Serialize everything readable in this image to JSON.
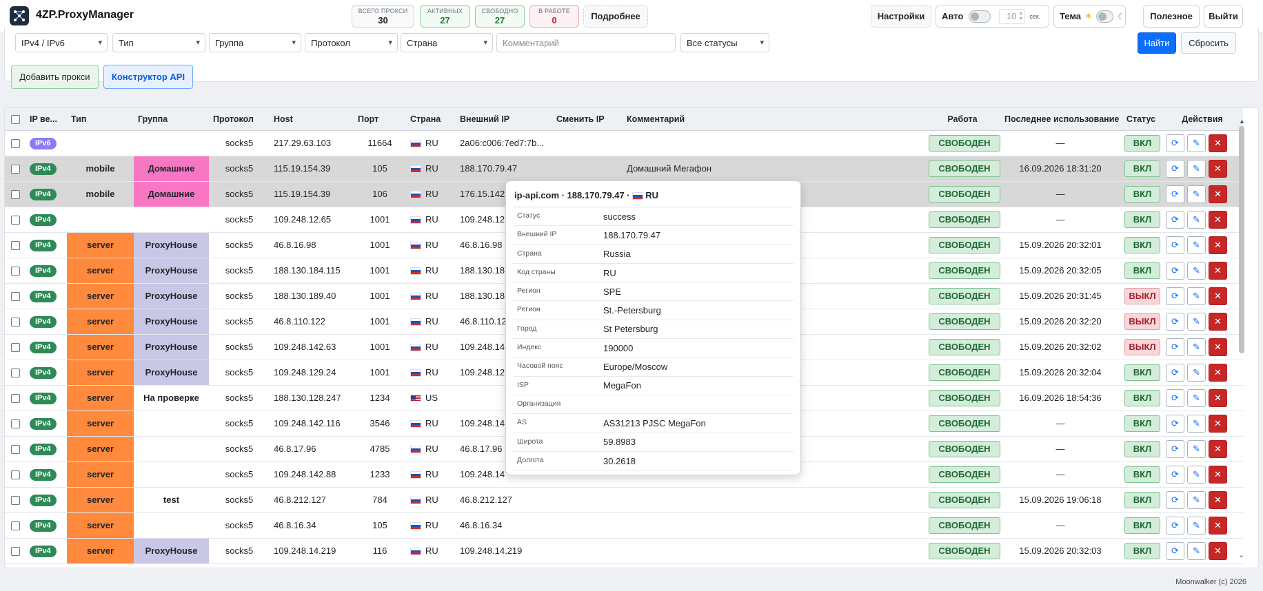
{
  "app": {
    "title": "4ZP.ProxyManager"
  },
  "stats": [
    {
      "label": "ВСЕГО ПРОКСИ",
      "value": "30"
    },
    {
      "label": "АКТИВНЫХ",
      "value": "27"
    },
    {
      "label": "СВОБОДНО",
      "value": "27"
    },
    {
      "label": "В РАБОТЕ",
      "value": "0"
    }
  ],
  "header": {
    "details_label": "Подробнее",
    "settings_label": "Настройки",
    "auto_label": "Авто",
    "auto_interval": "10",
    "auto_unit": "сек.",
    "theme_label": "Тема",
    "useful_label": "Полезное",
    "logout_label": "Выйти"
  },
  "filters": {
    "ip_version": "IPv4 / IPv6",
    "type": "Тип",
    "group": "Группа",
    "protocol": "Протокол",
    "country": "Страна",
    "comment_placeholder": "Комментарий",
    "status": "Все статусы",
    "find_label": "Найти",
    "reset_label": "Сбросить",
    "add_proxy_label": "Добавить прокси",
    "api_builder_label": "Конструктор API"
  },
  "table": {
    "columns": [
      "IP ве...",
      "Тип",
      "Группа",
      "Протокол",
      "Host",
      "Порт",
      "Страна",
      "Внешний IP",
      "Сменить IP",
      "Комментарий",
      "Работа",
      "Последнее использование",
      "Статус",
      "Действия"
    ],
    "rows": [
      {
        "ipv": "IPv6",
        "type": "",
        "group": "",
        "proto": "socks5",
        "host": "217.29.63.103",
        "port": "11664",
        "country": "RU",
        "ext": "2a06:c006:7ed7:7b...",
        "comment": "",
        "work": "СВОБОДЕН",
        "last": "—",
        "status": "ВКЛ"
      },
      {
        "ipv": "IPv4",
        "type": "mobile",
        "group": "Домашние",
        "proto": "socks5",
        "host": "115.19.154.39",
        "port": "105",
        "country": "RU",
        "ext": "188.170.79.47",
        "comment": "Домашний Мегафон",
        "work": "СВОБОДЕН",
        "last": "16.09.2026 18:31:20",
        "status": "ВКЛ"
      },
      {
        "ipv": "IPv4",
        "type": "mobile",
        "group": "Домашние",
        "proto": "socks5",
        "host": "115.19.154.39",
        "port": "106",
        "country": "RU",
        "ext": "176.15.142",
        "comment": "",
        "work": "СВОБОДЕН",
        "last": "—",
        "status": "ВКЛ"
      },
      {
        "ipv": "IPv4",
        "type": "",
        "group": "",
        "proto": "socks5",
        "host": "109.248.12.65",
        "port": "1001",
        "country": "RU",
        "ext": "109.248.12",
        "comment": "",
        "work": "СВОБОДЕН",
        "last": "—",
        "status": "ВКЛ"
      },
      {
        "ipv": "IPv4",
        "type": "server",
        "group": "ProxyHouse",
        "proto": "socks5",
        "host": "46.8.16.98",
        "port": "1001",
        "country": "RU",
        "ext": "46.8.16.98",
        "comment": "",
        "work": "СВОБОДЕН",
        "last": "15.09.2026 20:32:01",
        "status": "ВКЛ"
      },
      {
        "ipv": "IPv4",
        "type": "server",
        "group": "ProxyHouse",
        "proto": "socks5",
        "host": "188.130.184.115",
        "port": "1001",
        "country": "RU",
        "ext": "188.130.18",
        "comment": "",
        "work": "СВОБОДЕН",
        "last": "15.09.2026 20:32:05",
        "status": "ВКЛ"
      },
      {
        "ipv": "IPv4",
        "type": "server",
        "group": "ProxyHouse",
        "proto": "socks5",
        "host": "188.130.189.40",
        "port": "1001",
        "country": "RU",
        "ext": "188.130.18",
        "comment": "",
        "work": "СВОБОДЕН",
        "last": "15.09.2026 20:31:45",
        "status": "ВЫКЛ"
      },
      {
        "ipv": "IPv4",
        "type": "server",
        "group": "ProxyHouse",
        "proto": "socks5",
        "host": "46.8.110.122",
        "port": "1001",
        "country": "RU",
        "ext": "46.8.110.12",
        "comment": "",
        "work": "СВОБОДЕН",
        "last": "15.09.2026 20:32:20",
        "status": "ВЫКЛ"
      },
      {
        "ipv": "IPv4",
        "type": "server",
        "group": "ProxyHouse",
        "proto": "socks5",
        "host": "109.248.142.63",
        "port": "1001",
        "country": "RU",
        "ext": "109.248.14",
        "comment": "",
        "work": "СВОБОДЕН",
        "last": "15.09.2026 20:32:02",
        "status": "ВЫКЛ"
      },
      {
        "ipv": "IPv4",
        "type": "server",
        "group": "ProxyHouse",
        "proto": "socks5",
        "host": "109.248.129.24",
        "port": "1001",
        "country": "RU",
        "ext": "109.248.12",
        "comment": "",
        "work": "СВОБОДЕН",
        "last": "15.09.2026 20:32:04",
        "status": "ВКЛ"
      },
      {
        "ipv": "IPv4",
        "type": "server",
        "group": "На проверке",
        "proto": "socks5",
        "host": "188.130.128.247",
        "port": "1234",
        "country": "US",
        "ext": "",
        "comment": "",
        "work": "СВОБОДЕН",
        "last": "16.09.2026 18:54:36",
        "status": "ВКЛ"
      },
      {
        "ipv": "IPv4",
        "type": "server",
        "group": "",
        "proto": "socks5",
        "host": "109.248.142.116",
        "port": "3546",
        "country": "RU",
        "ext": "109.248.14",
        "comment": "",
        "work": "СВОБОДЕН",
        "last": "—",
        "status": "ВКЛ"
      },
      {
        "ipv": "IPv4",
        "type": "server",
        "group": "",
        "proto": "socks5",
        "host": "46.8.17.96",
        "port": "4785",
        "country": "RU",
        "ext": "46.8.17.96",
        "comment": "",
        "work": "СВОБОДЕН",
        "last": "—",
        "status": "ВКЛ"
      },
      {
        "ipv": "IPv4",
        "type": "server",
        "group": "",
        "proto": "socks5",
        "host": "109.248.142.88",
        "port": "1233",
        "country": "RU",
        "ext": "109.248.14",
        "comment": "",
        "work": "СВОБОДЕН",
        "last": "—",
        "status": "ВКЛ"
      },
      {
        "ipv": "IPv4",
        "type": "server",
        "group": "test",
        "proto": "socks5",
        "host": "46.8.212.127",
        "port": "784",
        "country": "RU",
        "ext": "46.8.212.127",
        "comment": "",
        "work": "СВОБОДЕН",
        "last": "15.09.2026 19:06:18",
        "status": "ВКЛ"
      },
      {
        "ipv": "IPv4",
        "type": "server",
        "group": "",
        "proto": "socks5",
        "host": "46.8.16.34",
        "port": "105",
        "country": "RU",
        "ext": "46.8.16.34",
        "comment": "",
        "work": "СВОБОДЕН",
        "last": "—",
        "status": "ВКЛ"
      },
      {
        "ipv": "IPv4",
        "type": "server",
        "group": "ProxyHouse",
        "proto": "socks5",
        "host": "109.248.14.219",
        "port": "116",
        "country": "RU",
        "ext": "109.248.14.219",
        "comment": "",
        "work": "СВОБОДЕН",
        "last": "15.09.2026 20:32:03",
        "status": "ВКЛ"
      }
    ]
  },
  "popup": {
    "title": "ip-api.com · 188.170.79.47 · ",
    "title_country": "RU",
    "rows": [
      {
        "k": "Статус",
        "v": "success"
      },
      {
        "k": "Внешний IP",
        "v": "188.170.79.47"
      },
      {
        "k": "Страна",
        "v": "Russia"
      },
      {
        "k": "Код страны",
        "v": "RU"
      },
      {
        "k": "Регион",
        "v": "SPE"
      },
      {
        "k": "Регион",
        "v": "St.-Petersburg"
      },
      {
        "k": "Город",
        "v": "St Petersburg"
      },
      {
        "k": "Индекс",
        "v": "190000"
      },
      {
        "k": "Часовой пояс",
        "v": "Europe/Moscow"
      },
      {
        "k": "ISP",
        "v": "MegaFon"
      },
      {
        "k": "Организация",
        "v": ""
      },
      {
        "k": "AS",
        "v": "AS31213 PJSC MegaFon"
      },
      {
        "k": "Широта",
        "v": "59.8983"
      },
      {
        "k": "Долгота",
        "v": "30.2618"
      }
    ]
  },
  "footer": {
    "text": "Moonwalker (c) 2026"
  },
  "colors": {
    "server_type": "#ff8a3d",
    "group_home": "#f777c4",
    "group_proxyhouse": "#c9c6e6",
    "primary": "#0d6efd",
    "danger": "#c62828"
  }
}
